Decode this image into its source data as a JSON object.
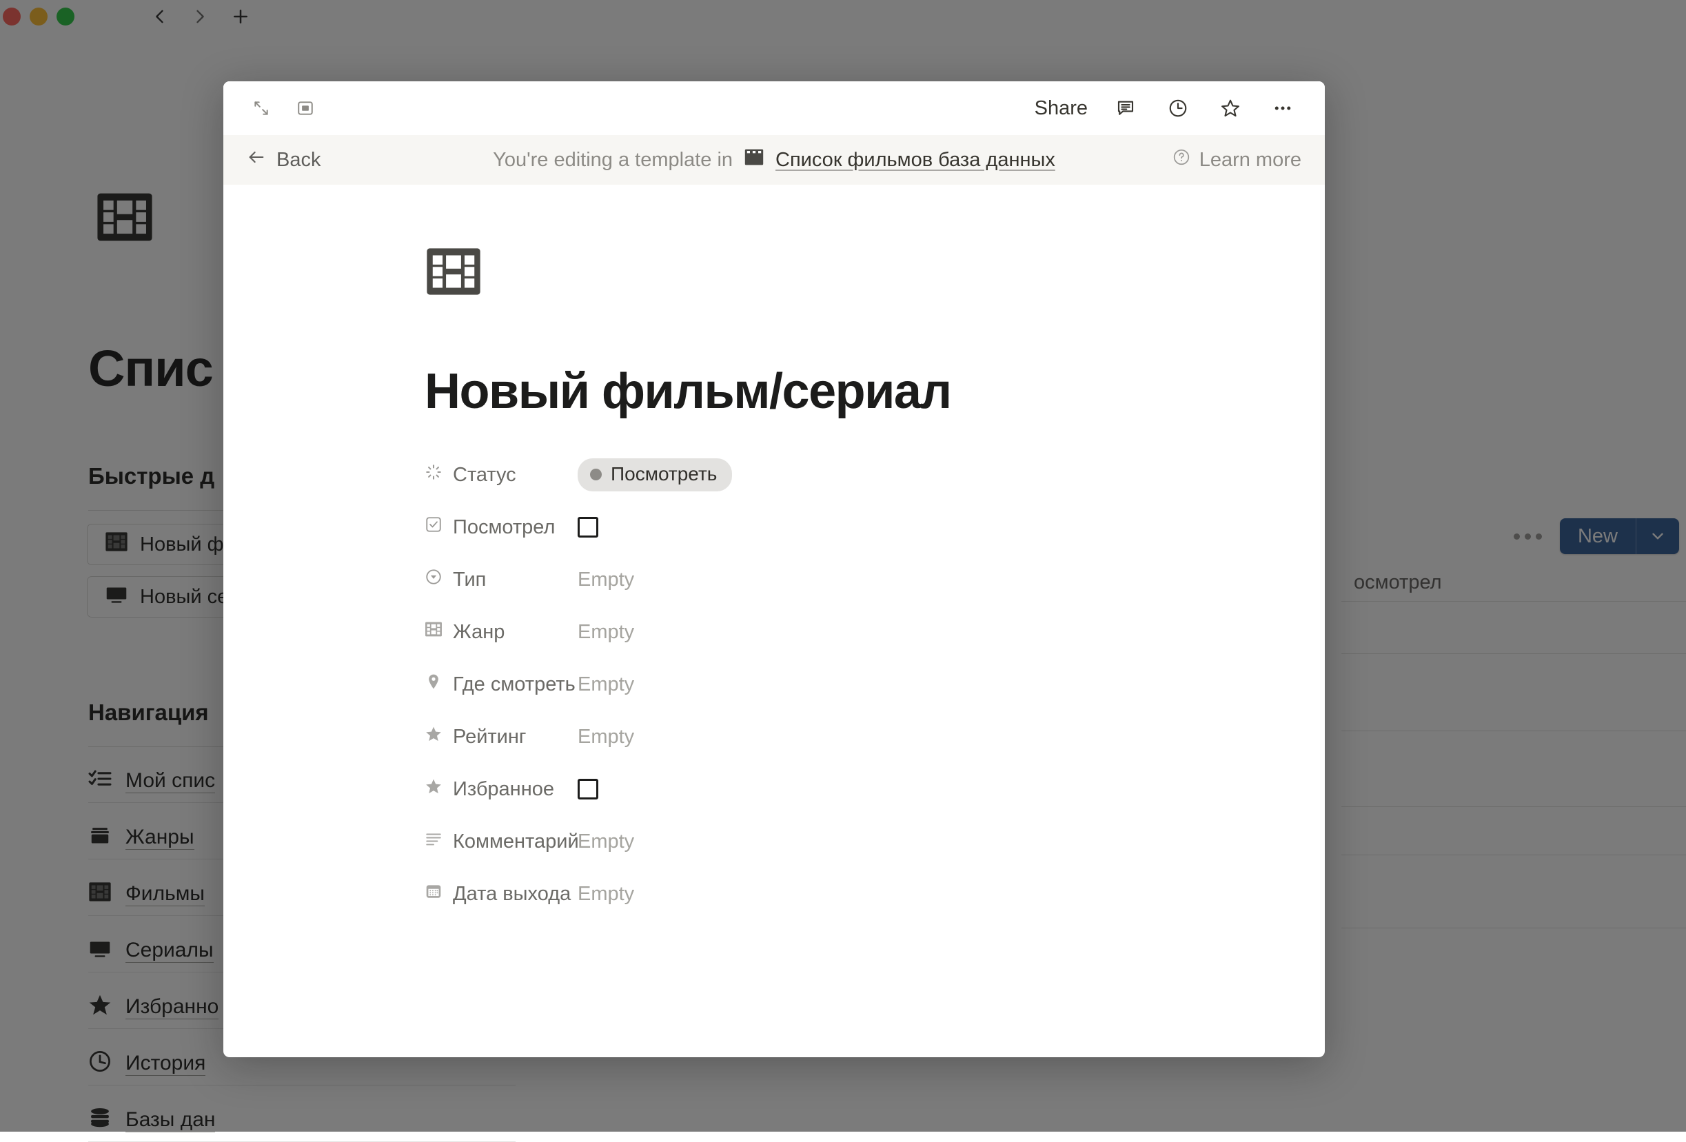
{
  "window": {
    "traffic_lights": [
      "red",
      "yellow",
      "green"
    ],
    "nav_back_icon": "chevron-left-icon",
    "nav_forward_icon": "chevron-right-icon",
    "new_tab_icon": "plus-icon"
  },
  "background_page": {
    "page_icon": "film-strip-icon",
    "title": "Спис",
    "sections": [
      {
        "heading": "Быстрые д"
      },
      {
        "heading": "Навигация"
      }
    ],
    "quick_actions": [
      {
        "icon": "film-strip-icon",
        "label": "Новый фи"
      },
      {
        "icon": "monitor-icon",
        "label": "Новый се"
      }
    ],
    "navigation": [
      {
        "icon": "checklist-icon",
        "label": "Мой спис"
      },
      {
        "icon": "archive-icon",
        "label": "Жанры"
      },
      {
        "icon": "film-strip-icon",
        "label": "Фильмы"
      },
      {
        "icon": "monitor-icon",
        "label": "Сериалы"
      },
      {
        "icon": "star-icon",
        "label": "Избранно"
      },
      {
        "icon": "clock-icon",
        "label": "История "
      },
      {
        "icon": "database-icon",
        "label": "Базы дан"
      }
    ],
    "table": {
      "more_icon": "ellipsis-icon",
      "new_button": {
        "label": "New",
        "chevron_icon": "chevron-down-icon",
        "color": "#2f5b96"
      },
      "column_header": "осмотрел",
      "row_count": 6
    }
  },
  "modal": {
    "topbar": {
      "expand_icon": "expand-arrows-icon",
      "sidepeek_icon": "side-peek-icon",
      "share_label": "Share",
      "comment_icon": "comment-icon",
      "history_icon": "clock-icon",
      "favorite_icon": "star-outline-icon",
      "more_icon": "ellipsis-icon"
    },
    "banner": {
      "back_icon": "arrow-left-icon",
      "back_label": "Back",
      "message": "You're editing a template in",
      "database_icon": "film-strip-icon",
      "database_name": "Список фильмов база данных",
      "help_icon": "question-circle-icon",
      "learn_more_label": "Learn more"
    },
    "page_icon": "film-strip-icon",
    "page_title": "Новый фильм/сериал",
    "properties": [
      {
        "icon": "status-spinner-icon",
        "name": "Статус",
        "value_type": "select-pill",
        "value": "Посмотреть",
        "pill_bg": "#e3e2e0",
        "pill_dot": "#8d8b87"
      },
      {
        "icon": "checkbox-icon",
        "name": "Посмотрел",
        "value_type": "checkbox",
        "value": ""
      },
      {
        "icon": "select-circle-icon",
        "name": "Тип",
        "value_type": "text",
        "value": "Empty"
      },
      {
        "icon": "film-strip-icon",
        "name": "Жанр",
        "value_type": "text",
        "value": "Empty"
      },
      {
        "icon": "map-pin-icon",
        "name": "Где смотреть",
        "value_type": "text",
        "value": "Empty"
      },
      {
        "icon": "star-icon",
        "name": "Рейтинг",
        "value_type": "text",
        "value": "Empty"
      },
      {
        "icon": "star-icon",
        "name": "Избранное",
        "value_type": "checkbox",
        "value": ""
      },
      {
        "icon": "text-lines-icon",
        "name": "Комментарий",
        "value_type": "text",
        "value": "Empty"
      },
      {
        "icon": "calendar-icon",
        "name": "Дата выхода",
        "value_type": "text",
        "value": "Empty"
      }
    ]
  }
}
